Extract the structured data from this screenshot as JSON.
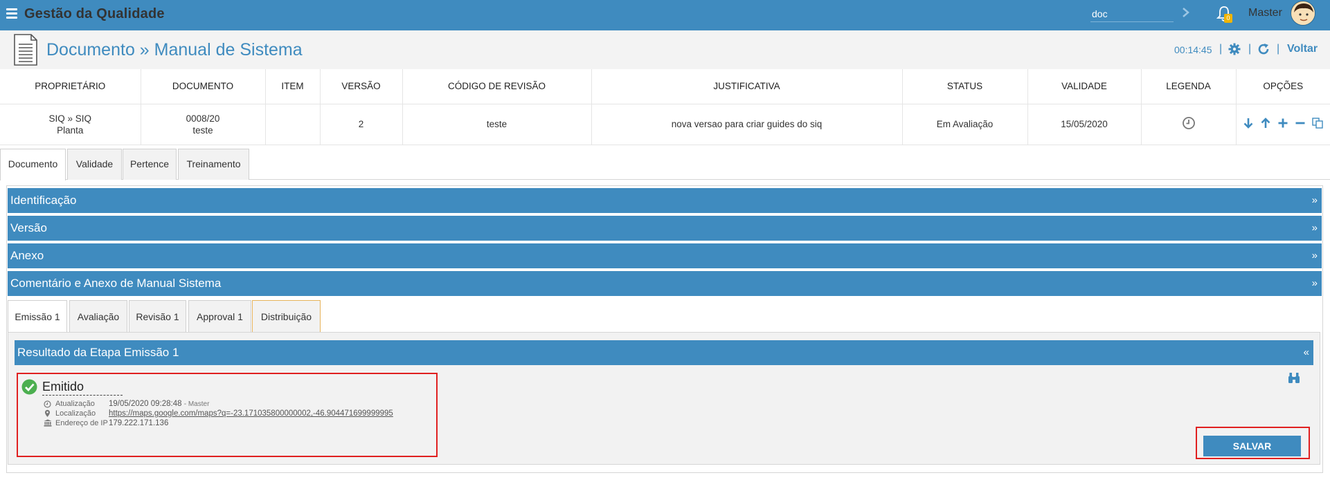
{
  "topbar": {
    "app_title": "Gestão da Qualidade",
    "search_value": "doc",
    "notification_count": "0",
    "user_name": "Master"
  },
  "header": {
    "title": "Documento » Manual de Sistema",
    "timer": "00:14:45",
    "back_label": "Voltar"
  },
  "table": {
    "columns": [
      "PROPRIETÁRIO",
      "DOCUMENTO",
      "ITEM",
      "VERSÃO",
      "CÓDIGO DE REVISÃO",
      "JUSTIFICATIVA",
      "STATUS",
      "VALIDADE",
      "LEGENDA",
      "OPÇÕES"
    ],
    "row": {
      "owner_line1": "SIQ » SIQ",
      "owner_line2": "Planta",
      "document_line1": "0008/20",
      "document_line2": "teste",
      "item": "",
      "version": "2",
      "revision_code": "teste",
      "justification": "nova versao para criar guides do siq",
      "status": "Em Avaliação",
      "validity": "15/05/2020"
    }
  },
  "tabs": [
    "Documento",
    "Validade",
    "Pertence",
    "Treinamento"
  ],
  "accordions": [
    "Identificação",
    "Versão",
    "Anexo",
    "Comentário e Anexo de Manual Sistema"
  ],
  "accordion_arrow": "»",
  "sub_tabs": [
    "Emissão 1",
    "Avaliação",
    "Revisão 1",
    "Approval 1",
    "Distribuição"
  ],
  "result": {
    "header": "Resultado da Etapa Emissão 1",
    "collapse_arrow": "«",
    "status": "Emitido",
    "update_label": "Atualização",
    "update_value": "19/05/2020 09:28:48",
    "update_by": "- Master",
    "location_label": "Localização",
    "location_value": "https://maps.google.com/maps?q=-23.171035800000002,-46.904471699999995",
    "ip_label": "Endereço de IP",
    "ip_value": "179.222.171.136"
  },
  "save_label": "SALVAR",
  "colors": {
    "primary": "#3f8bbf",
    "highlight": "#e02020",
    "success": "#4caf50",
    "badge": "#f0b400"
  }
}
